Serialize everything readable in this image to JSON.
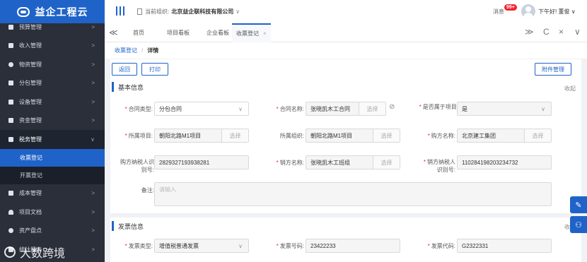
{
  "app": {
    "logo_text": "益企工程云"
  },
  "header": {
    "org_label": "当前组织:",
    "org_name": "北京益企联科技有限公司",
    "org_chevron": "∨",
    "message_label": "消息",
    "message_badge": "99+",
    "greeting": "下午好! 董俊",
    "greeting_chevron": "∨"
  },
  "sidebar": {
    "items": [
      {
        "label": "预算管理",
        "icon": "budget-icon"
      },
      {
        "label": "收入管理",
        "icon": "income-icon"
      },
      {
        "label": "物资管理",
        "icon": "material-icon"
      },
      {
        "label": "分包管理",
        "icon": "subcontract-icon"
      },
      {
        "label": "设备管理",
        "icon": "equipment-icon"
      },
      {
        "label": "资金管理",
        "icon": "funds-icon"
      },
      {
        "label": "税务管理",
        "icon": "tax-icon"
      }
    ],
    "sub_items": [
      {
        "label": "收票登记"
      },
      {
        "label": "开票登记"
      }
    ],
    "items_after": [
      {
        "label": "成本管理",
        "icon": "cost-icon"
      },
      {
        "label": "项目文档",
        "icon": "document-icon"
      },
      {
        "label": "资产盘点",
        "icon": "asset-icon"
      },
      {
        "label": "统计报表",
        "icon": "report-icon"
      }
    ],
    "arrow": ">",
    "arrow_open": "∨",
    "watermark": "大数跨境"
  },
  "tabs": {
    "collapse": "≪",
    "items": [
      {
        "label": "首页"
      },
      {
        "label": "项目看板"
      },
      {
        "label": "企业看板"
      },
      {
        "label": "收票登记",
        "close": "×"
      }
    ],
    "right_icons": [
      "≫",
      "C",
      "×",
      "∨"
    ]
  },
  "breadcrumb": {
    "parent": "收票登记",
    "separator": "/",
    "current": "详情"
  },
  "toolbar": {
    "back": "返回",
    "print": "打印",
    "attachments": "附件管理"
  },
  "basic_info": {
    "title": "基本信息",
    "collapse": "收起",
    "fields": {
      "contract_type": {
        "label": "合同类型:",
        "value": "分包合同",
        "required": "*"
      },
      "contract_name": {
        "label": "合同名称:",
        "value": "张晓凯木工合同",
        "pick": "选择",
        "required": "*"
      },
      "is_project": {
        "label": "是否属于项目:",
        "value": "是",
        "required": "*"
      },
      "project": {
        "label": "所属项目:",
        "value": "朝阳北路M1项目",
        "pick": "选择",
        "required": "*"
      },
      "org": {
        "label": "所属组织:",
        "value": "朝阳北路M1项目",
        "pick": "选择"
      },
      "buyer_name": {
        "label": "购方名称:",
        "value": "北京建工集团",
        "pick": "选择",
        "required": "*"
      },
      "buyer_tax_id": {
        "label": "购方纳税人识别号:",
        "value": "2829327193938281"
      },
      "seller_name": {
        "label": "销方名称:",
        "value": "张晓凯木工班组",
        "pick": "选择",
        "required": "*"
      },
      "seller_tax_id": {
        "label": "销方纳税人识别号:",
        "value": "110284198203234732",
        "required": "*"
      },
      "remark": {
        "label": "备注:",
        "placeholder": "请输入"
      }
    }
  },
  "invoice_info": {
    "title": "发票信息",
    "collapse": "收起",
    "fields": {
      "invoice_type": {
        "label": "发票类型:",
        "value": "增值税普通发票",
        "required": "*"
      },
      "invoice_number": {
        "label": "发票号码:",
        "value": "23422233",
        "required": "*"
      },
      "invoice_code": {
        "label": "发票代码:",
        "value": "G2322331",
        "required": "*"
      }
    }
  },
  "colors": {
    "primary": "#1f63c8",
    "sidebar": "#2a2f3a",
    "badge": "#f5222d"
  }
}
